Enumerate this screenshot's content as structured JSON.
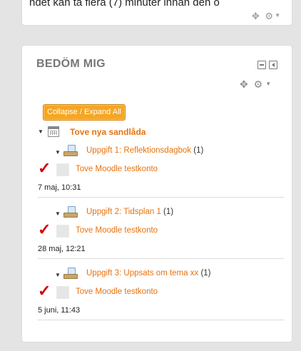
{
  "top_block": {
    "text": "ndet kan ta flera (7) minuter innan den o",
    "controls_icons": [
      "move-icon",
      "gear-icon",
      "caret-down-icon"
    ]
  },
  "block": {
    "title": "BEDÖM MIG",
    "collapse_expand_label": "Collapse / Expand All",
    "course": "Tove nya sandlåda",
    "assignments": [
      {
        "name": "Uppgift 1: Reflektionsdagbok",
        "count": "(1)",
        "student": "Tove Moodle testkonto",
        "date": "7 maj, 10:31"
      },
      {
        "name": "Uppgift 2: Tidsplan 1",
        "count": "(1)",
        "student": "Tove Moodle testkonto",
        "date": "28 maj, 12:21"
      },
      {
        "name": "Uppgift 3: Uppsats om tema xx",
        "count": "(1)",
        "student": "Tove Moodle testkonto",
        "date": "5 juni, 11:43"
      }
    ]
  },
  "colors": {
    "accent_orange": "#e8720c",
    "button_orange": "#f5a623",
    "check_red": "#d40000",
    "background": "#e4e4e4"
  }
}
